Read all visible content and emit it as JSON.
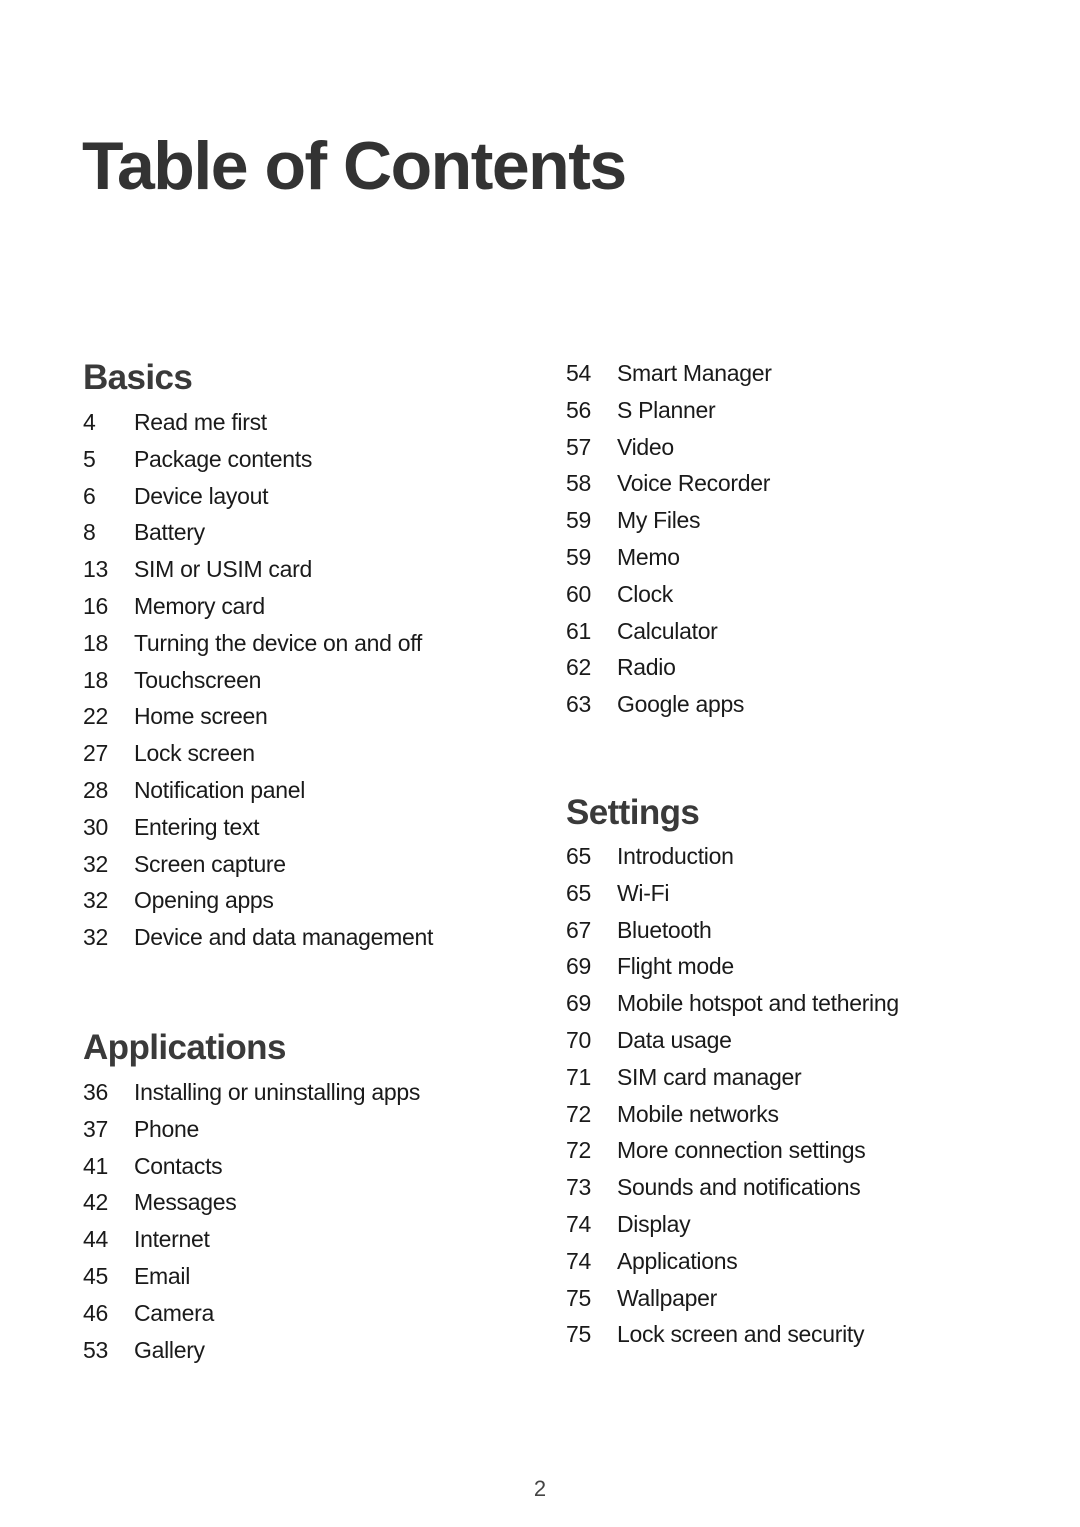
{
  "page": {
    "title": "Table of Contents",
    "page_number": "2"
  },
  "sections": {
    "basics": {
      "heading": "Basics",
      "items": [
        {
          "page": "4",
          "label": "Read me first"
        },
        {
          "page": "5",
          "label": "Package contents"
        },
        {
          "page": "6",
          "label": "Device layout"
        },
        {
          "page": "8",
          "label": "Battery"
        },
        {
          "page": "13",
          "label": "SIM or USIM card"
        },
        {
          "page": "16",
          "label": "Memory card"
        },
        {
          "page": "18",
          "label": "Turning the device on and off"
        },
        {
          "page": "18",
          "label": "Touchscreen"
        },
        {
          "page": "22",
          "label": "Home screen"
        },
        {
          "page": "27",
          "label": "Lock screen"
        },
        {
          "page": "28",
          "label": "Notification panel"
        },
        {
          "page": "30",
          "label": "Entering text"
        },
        {
          "page": "32",
          "label": "Screen capture"
        },
        {
          "page": "32",
          "label": "Opening apps"
        },
        {
          "page": "32",
          "label": "Device and data management"
        }
      ]
    },
    "applications": {
      "heading": "Applications",
      "items": [
        {
          "page": "36",
          "label": "Installing or uninstalling apps"
        },
        {
          "page": "37",
          "label": "Phone"
        },
        {
          "page": "41",
          "label": "Contacts"
        },
        {
          "page": "42",
          "label": "Messages"
        },
        {
          "page": "44",
          "label": "Internet"
        },
        {
          "page": "45",
          "label": "Email"
        },
        {
          "page": "46",
          "label": "Camera"
        },
        {
          "page": "53",
          "label": "Gallery"
        }
      ],
      "continued_items": [
        {
          "page": "54",
          "label": "Smart Manager"
        },
        {
          "page": "56",
          "label": "S Planner"
        },
        {
          "page": "57",
          "label": "Video"
        },
        {
          "page": "58",
          "label": "Voice Recorder"
        },
        {
          "page": "59",
          "label": "My Files"
        },
        {
          "page": "59",
          "label": "Memo"
        },
        {
          "page": "60",
          "label": "Clock"
        },
        {
          "page": "61",
          "label": "Calculator"
        },
        {
          "page": "62",
          "label": "Radio"
        },
        {
          "page": "63",
          "label": "Google apps"
        }
      ]
    },
    "settings": {
      "heading": "Settings",
      "items": [
        {
          "page": "65",
          "label": "Introduction"
        },
        {
          "page": "65",
          "label": "Wi-Fi"
        },
        {
          "page": "67",
          "label": "Bluetooth"
        },
        {
          "page": "69",
          "label": "Flight mode"
        },
        {
          "page": "69",
          "label": "Mobile hotspot and tethering"
        },
        {
          "page": "70",
          "label": "Data usage"
        },
        {
          "page": "71",
          "label": "SIM card manager"
        },
        {
          "page": "72",
          "label": "Mobile networks"
        },
        {
          "page": "72",
          "label": "More connection settings"
        },
        {
          "page": "73",
          "label": "Sounds and notifications"
        },
        {
          "page": "74",
          "label": "Display"
        },
        {
          "page": "74",
          "label": "Applications"
        },
        {
          "page": "75",
          "label": "Wallpaper"
        },
        {
          "page": "75",
          "label": "Lock screen and security"
        }
      ]
    }
  }
}
